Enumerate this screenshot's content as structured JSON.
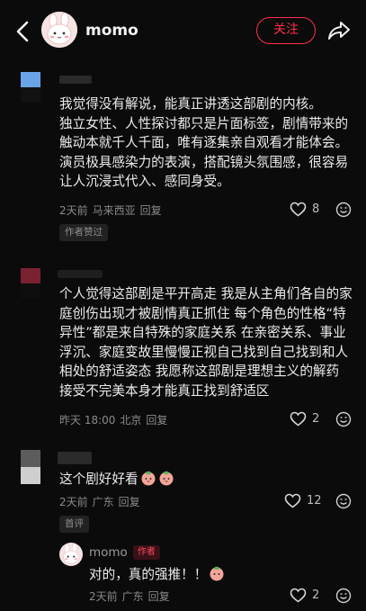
{
  "header": {
    "author_name": "momo",
    "follow_label": "关注",
    "back_icon": "chevron-left-icon",
    "share_icon": "share-arrow-icon",
    "accent_color": "#ff2e4d"
  },
  "comments": [
    {
      "text": "我觉得没有解说，能真正讲透这部剧的内核。\n独立女性、人性探讨都只是片面标签，剧情带来的触动本就千人千面，唯有逐集亲自观看才能体会。演员极具感染力的表演，搭配镜头氛围感，很容易让人沉浸式代入、感同身受。",
      "time": "2天前",
      "location": "马来西亚",
      "reply_label": "回复",
      "likes": "8",
      "tag": "作者赞过"
    },
    {
      "text": "个人觉得这部剧是平开高走 我是从主角们各自的家庭创伤出现才被剧情真正抓住 每个角色的性格“特异性”都是来自特殊的家庭关系 在亲密关系、事业浮沉、家庭变故里慢慢正视自己找到自己找到和人相处的舒适姿态 我愿称这部剧是理想主义的解药 接受不完美本身才能真正找到舒适区",
      "time": "昨天 18:00",
      "location": "北京",
      "reply_label": "回复",
      "likes": "2"
    },
    {
      "text": "这个剧好好看",
      "time": "2天前",
      "location": "广东",
      "reply_label": "回复",
      "likes": "12",
      "tag": "首评"
    }
  ],
  "reply": {
    "author_name": "momo",
    "author_tag": "作者",
    "text": "对的，真的强推！！",
    "time": "2天前",
    "location": "广东",
    "reply_label": "回复",
    "likes": "2"
  }
}
